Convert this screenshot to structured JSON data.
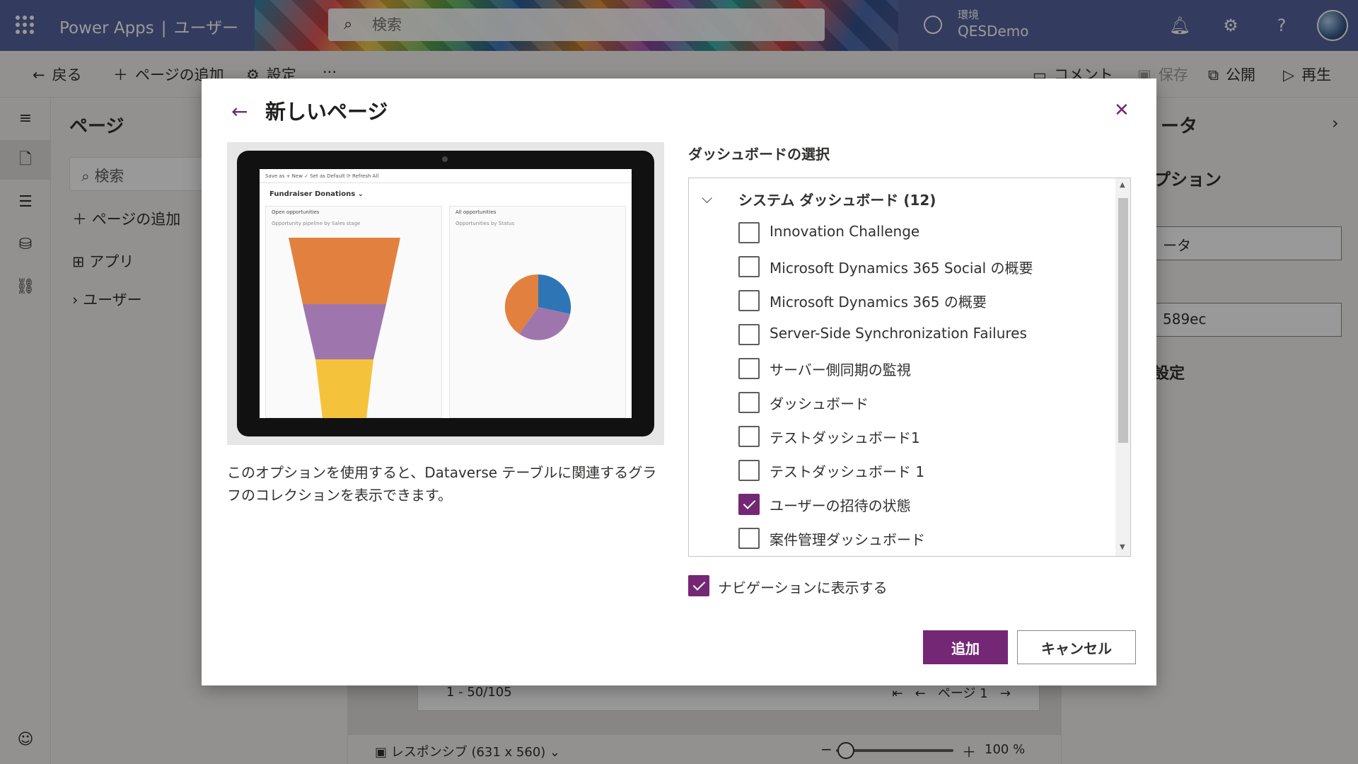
{
  "header": {
    "app_name": "Power Apps",
    "separator": "|",
    "page_name": "ユーザー",
    "search_placeholder": "検索",
    "environment_label": "環境",
    "environment_name": "QESDemo"
  },
  "toolbar": {
    "back": "戻る",
    "add_page": "ページの追加",
    "settings": "設定",
    "more": "···",
    "comments": "コメント",
    "save": "保存",
    "publish": "公開",
    "play": "再生"
  },
  "pages_panel": {
    "title": "ページ",
    "search_placeholder": "検索",
    "add_page": "ページの追加",
    "items": [
      "アプリ",
      "ユーザー"
    ]
  },
  "canvas": {
    "record_count": "1 - 50/105",
    "pager_label": "ページ 1",
    "responsive_label": "レスポンシブ (631 x 560)",
    "zoom": "100 %"
  },
  "right_panel": {
    "title": "ータ",
    "subtitle": "プション",
    "field1": "ータ",
    "field2": "589ec",
    "subtitle2": "設定"
  },
  "dialog": {
    "title": "新しいページ",
    "description": "このオプションを使用すると、Dataverse テーブルに関連するグラフのコレクションを表示できます。",
    "select_label": "ダッシュボードの選択",
    "group_label": "システム ダッシュボード (12)",
    "items": [
      {
        "label": "Innovation Challenge",
        "checked": false
      },
      {
        "label": "Microsoft Dynamics 365 Social の概要",
        "checked": false
      },
      {
        "label": "Microsoft Dynamics 365 の概要",
        "checked": false
      },
      {
        "label": "Server-Side Synchronization Failures",
        "checked": false
      },
      {
        "label": "サーバー側同期の監視",
        "checked": false
      },
      {
        "label": "ダッシュボード",
        "checked": false
      },
      {
        "label": "テストダッシュボード1",
        "checked": false
      },
      {
        "label": "テストダッシュボード 1",
        "checked": false
      },
      {
        "label": "ユーザーの招待の状態",
        "checked": true
      },
      {
        "label": "案件管理ダッシュボード",
        "checked": false
      }
    ],
    "show_in_nav": "ナビゲーションに表示する",
    "show_in_nav_checked": true,
    "add_button": "追加",
    "cancel_button": "キャンセル",
    "preview": {
      "toolbar": "Save as    + New    ✓ Set as Default    ⟳ Refresh All",
      "dashboard_title": "Fundraiser Donations ⌄",
      "card1_title": "Open opportunities",
      "card1_subtitle": "Opportunity pipeline by Sales stage",
      "card2_title": "All opportunities",
      "card2_subtitle": "Opportunities by Status"
    }
  },
  "colors": {
    "accent": "#742774",
    "header_bg": "#55659f",
    "funnel": [
      "#e2813f",
      "#9e76ad",
      "#f5c33b"
    ],
    "pie": [
      "#2e75b6",
      "#9e76ad",
      "#e2813f"
    ]
  }
}
